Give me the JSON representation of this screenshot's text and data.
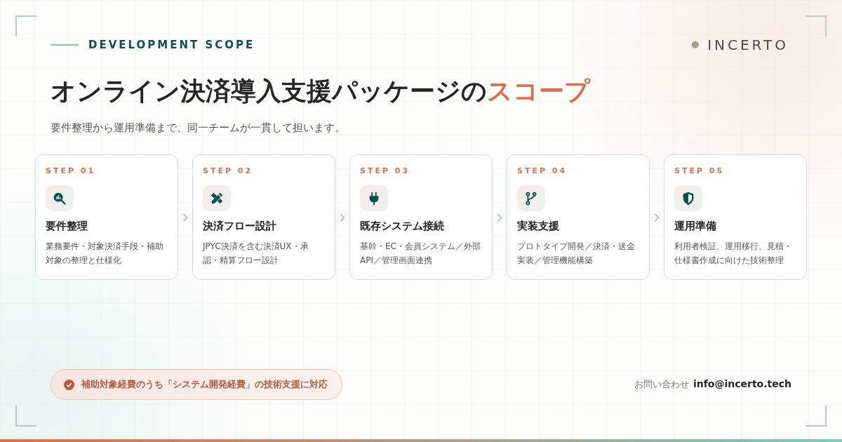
{
  "header": {
    "eyebrow": "DEVELOPMENT SCOPE",
    "logo": "INCERTO"
  },
  "title": {
    "main": "オンライン決済導入支援パッケージの",
    "accent": "スコープ"
  },
  "subtitle": "要件整理から運用準備まで、同一チームが一貫して担います。",
  "steps": [
    {
      "step": "STEP 01",
      "title": "要件整理",
      "description": "業務要件・対象決済手段・補助対象の整理と仕様化"
    },
    {
      "step": "STEP 02",
      "title": "決済フロー設計",
      "description": "JPYC決済を含む決済UX・承認・精算フロー設計"
    },
    {
      "step": "STEP 03",
      "title": "既存システム接続",
      "description": "基幹・EC・会員システム／外部API／管理画面連携"
    },
    {
      "step": "STEP 04",
      "title": "実装支援",
      "description": "プロトタイプ開発／決済・送金実装／管理機能構築"
    },
    {
      "step": "STEP 05",
      "title": "運用準備",
      "description": "利用者検証、運用移行、見積・仕様書作成に向けた技術整理"
    }
  ],
  "footer": {
    "badge": "補助対象経費のうち「システム開発経費」の技術支援に対応",
    "contact_label": "お問い合わせ",
    "contact_email": "info@incerto.tech"
  }
}
